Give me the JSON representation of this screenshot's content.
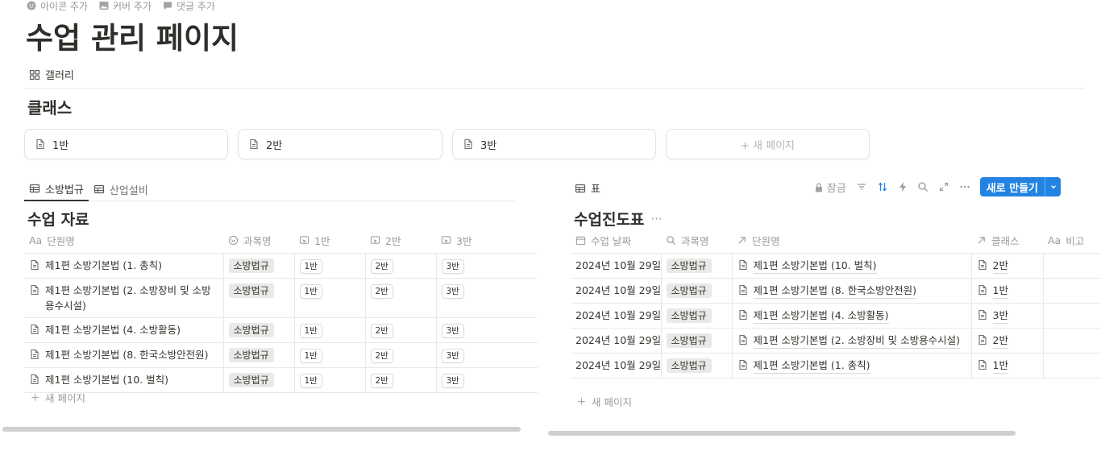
{
  "top_actions": [
    {
      "icon": "smile-icon",
      "label": "아이콘 추가"
    },
    {
      "icon": "image-icon",
      "label": "커버 추가"
    },
    {
      "icon": "comment-icon",
      "label": "댓글 추가"
    }
  ],
  "page_title": "수업 관리 페이지",
  "top_view": {
    "icon": "gallery-icon",
    "label": "갤러리"
  },
  "classes": {
    "title": "클래스",
    "cards": [
      {
        "icon": "page-icon",
        "label": "1반"
      },
      {
        "icon": "page-icon",
        "label": "2반"
      },
      {
        "icon": "page-icon",
        "label": "3반"
      }
    ],
    "new_label": "+ 새 페이지"
  },
  "left_db": {
    "tabs": [
      {
        "icon": "table-icon",
        "label": "소방법규",
        "active": true
      },
      {
        "icon": "table-icon",
        "label": "산업설비",
        "active": false
      }
    ],
    "title": "수업 자료",
    "columns": [
      {
        "icon": "Aa",
        "label": "단원명"
      },
      {
        "icon": "select-icon",
        "label": "과목명"
      },
      {
        "icon": "relation-icon",
        "label": "1반"
      },
      {
        "icon": "relation-icon",
        "label": "2반"
      },
      {
        "icon": "relation-icon",
        "label": "3반"
      }
    ],
    "rows": [
      {
        "name": "제1편 소방기본법 (1. 총칙)",
        "subject": "소방법규",
        "c1": "1반",
        "c2": "2반",
        "c3": "3반"
      },
      {
        "name": "제1편 소방기본법 (2. 소방장비 및 소방용수시설)",
        "subject": "소방법규",
        "c1": "1반",
        "c2": "2반",
        "c3": "3반"
      },
      {
        "name": "제1편 소방기본법 (4. 소방활동)",
        "subject": "소방법규",
        "c1": "1반",
        "c2": "2반",
        "c3": "3반"
      },
      {
        "name": "제1편 소방기본법 (8. 한국소방안전원)",
        "subject": "소방법규",
        "c1": "1반",
        "c2": "2반",
        "c3": "3반"
      },
      {
        "name": "제1편 소방기본법 (10. 벌칙)",
        "subject": "소방법규",
        "c1": "1반",
        "c2": "2반",
        "c3": "3반"
      }
    ],
    "new_row": "새 페이지"
  },
  "right_db": {
    "view_tab": {
      "icon": "table-icon",
      "label": "표"
    },
    "toolbar": {
      "lock_label": "잠금",
      "new_button": "새로 만들기"
    },
    "title": "수업진도표",
    "more": "···",
    "columns": [
      {
        "icon": "calendar-icon",
        "label": "수업 날짜"
      },
      {
        "icon": "search-icon",
        "label": "과목명"
      },
      {
        "icon": "arrow-up-right-icon",
        "label": "단원명"
      },
      {
        "icon": "arrow-up-right-icon",
        "label": "클래스"
      },
      {
        "icon": "Aa",
        "label": "비고"
      }
    ],
    "rows": [
      {
        "date": "2024년 10월 29일",
        "subject": "소방법규",
        "unit": "제1편 소방기본법 (10. 벌칙)",
        "cls": "2반"
      },
      {
        "date": "2024년 10월 29일",
        "subject": "소방법규",
        "unit": "제1편 소방기본법 (8. 한국소방안전원)",
        "cls": "1반"
      },
      {
        "date": "2024년 10월 29일",
        "subject": "소방법규",
        "unit": "제1편 소방기본법 (4. 소방활동)",
        "cls": "3반"
      },
      {
        "date": "2024년 10월 29일",
        "subject": "소방법규",
        "unit": "제1편 소방기본법 (2. 소방장비 및 소방용수시설)",
        "cls": "2반"
      },
      {
        "date": "2024년 10월 29일",
        "subject": "소방법규",
        "unit": "제1편 소방기본법 (1. 총칙)",
        "cls": "1반"
      }
    ],
    "new_row": "새 페이지"
  },
  "colors": {
    "accent": "#2383e2",
    "border": "#e9e9e7",
    "muted": "#9b9a97"
  }
}
